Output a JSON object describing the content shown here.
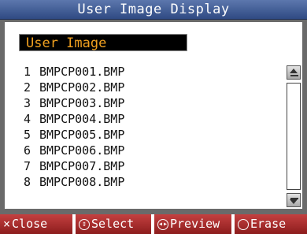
{
  "window": {
    "title": "User Image Display"
  },
  "folder": {
    "label": "User Image"
  },
  "files": [
    {
      "num": "1",
      "name": "BMPCP001.BMP"
    },
    {
      "num": "2",
      "name": "BMPCP002.BMP"
    },
    {
      "num": "3",
      "name": "BMPCP003.BMP"
    },
    {
      "num": "4",
      "name": "BMPCP004.BMP"
    },
    {
      "num": "5",
      "name": "BMPCP005.BMP"
    },
    {
      "num": "6",
      "name": "BMPCP006.BMP"
    },
    {
      "num": "7",
      "name": "BMPCP007.BMP"
    },
    {
      "num": "8",
      "name": "BMPCP008.BMP"
    }
  ],
  "footer": {
    "close": {
      "icon": "×",
      "label": "Close"
    },
    "select": {
      "label": "Select"
    },
    "preview": {
      "label": "Preview"
    },
    "erase": {
      "label": "Erase"
    }
  },
  "colors": {
    "titlebar": "#3d5a94",
    "folder_text": "#f0a020",
    "footer": "#8b1e1e"
  }
}
